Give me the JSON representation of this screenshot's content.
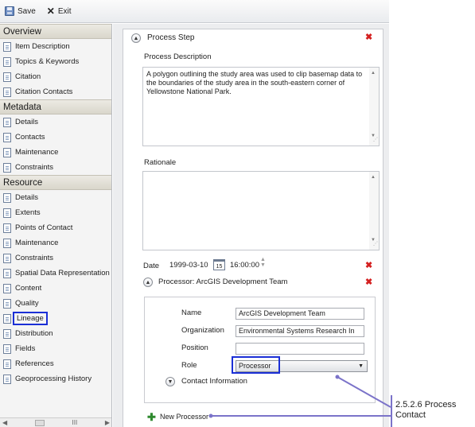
{
  "toolbar": {
    "save_label": "Save",
    "exit_label": "Exit"
  },
  "sidebar": {
    "overview": {
      "title": "Overview",
      "items": [
        "Item Description",
        "Topics & Keywords",
        "Citation",
        "Citation Contacts"
      ]
    },
    "metadata": {
      "title": "Metadata",
      "items": [
        "Details",
        "Contacts",
        "Maintenance",
        "Constraints"
      ]
    },
    "resource": {
      "title": "Resource",
      "items": [
        "Details",
        "Extents",
        "Points of Contact",
        "Maintenance",
        "Constraints",
        "Spatial Data Representation",
        "Content",
        "Quality",
        "Lineage",
        "Distribution",
        "Fields",
        "References",
        "Geoprocessing History"
      ]
    },
    "selected": "Lineage",
    "scroll_glyph": "III"
  },
  "process_step": {
    "title": "Process Step",
    "description_label": "Process Description",
    "description_text": "A polygon outlining the study area was used to clip basemap data to the boundaries of the study area in the south-eastern corner of Yellowstone National Park.",
    "rationale_label": "Rationale",
    "rationale_text": "",
    "date_label": "Date",
    "date_value": "1999-03-10",
    "calendar_day": "15",
    "time_value": "16:00:00"
  },
  "processor": {
    "title": "Processor: ArcGIS Development Team",
    "name_label": "Name",
    "name_value": "ArcGIS Development Team",
    "organization_label": "Organization",
    "organization_value": "Environmental Systems Research In",
    "position_label": "Position",
    "position_value": "",
    "role_label": "Role",
    "role_value": "Processor",
    "contact_info_label": "Contact Information",
    "new_processor_label": "New Processor"
  },
  "callout": {
    "line1": "2.5.2.6 Process",
    "line2": "Contact"
  },
  "colors": {
    "highlight": "#1b2fd6",
    "callout_line": "#7b73c9",
    "delete": "#d42020",
    "add": "#2f8a2f"
  }
}
